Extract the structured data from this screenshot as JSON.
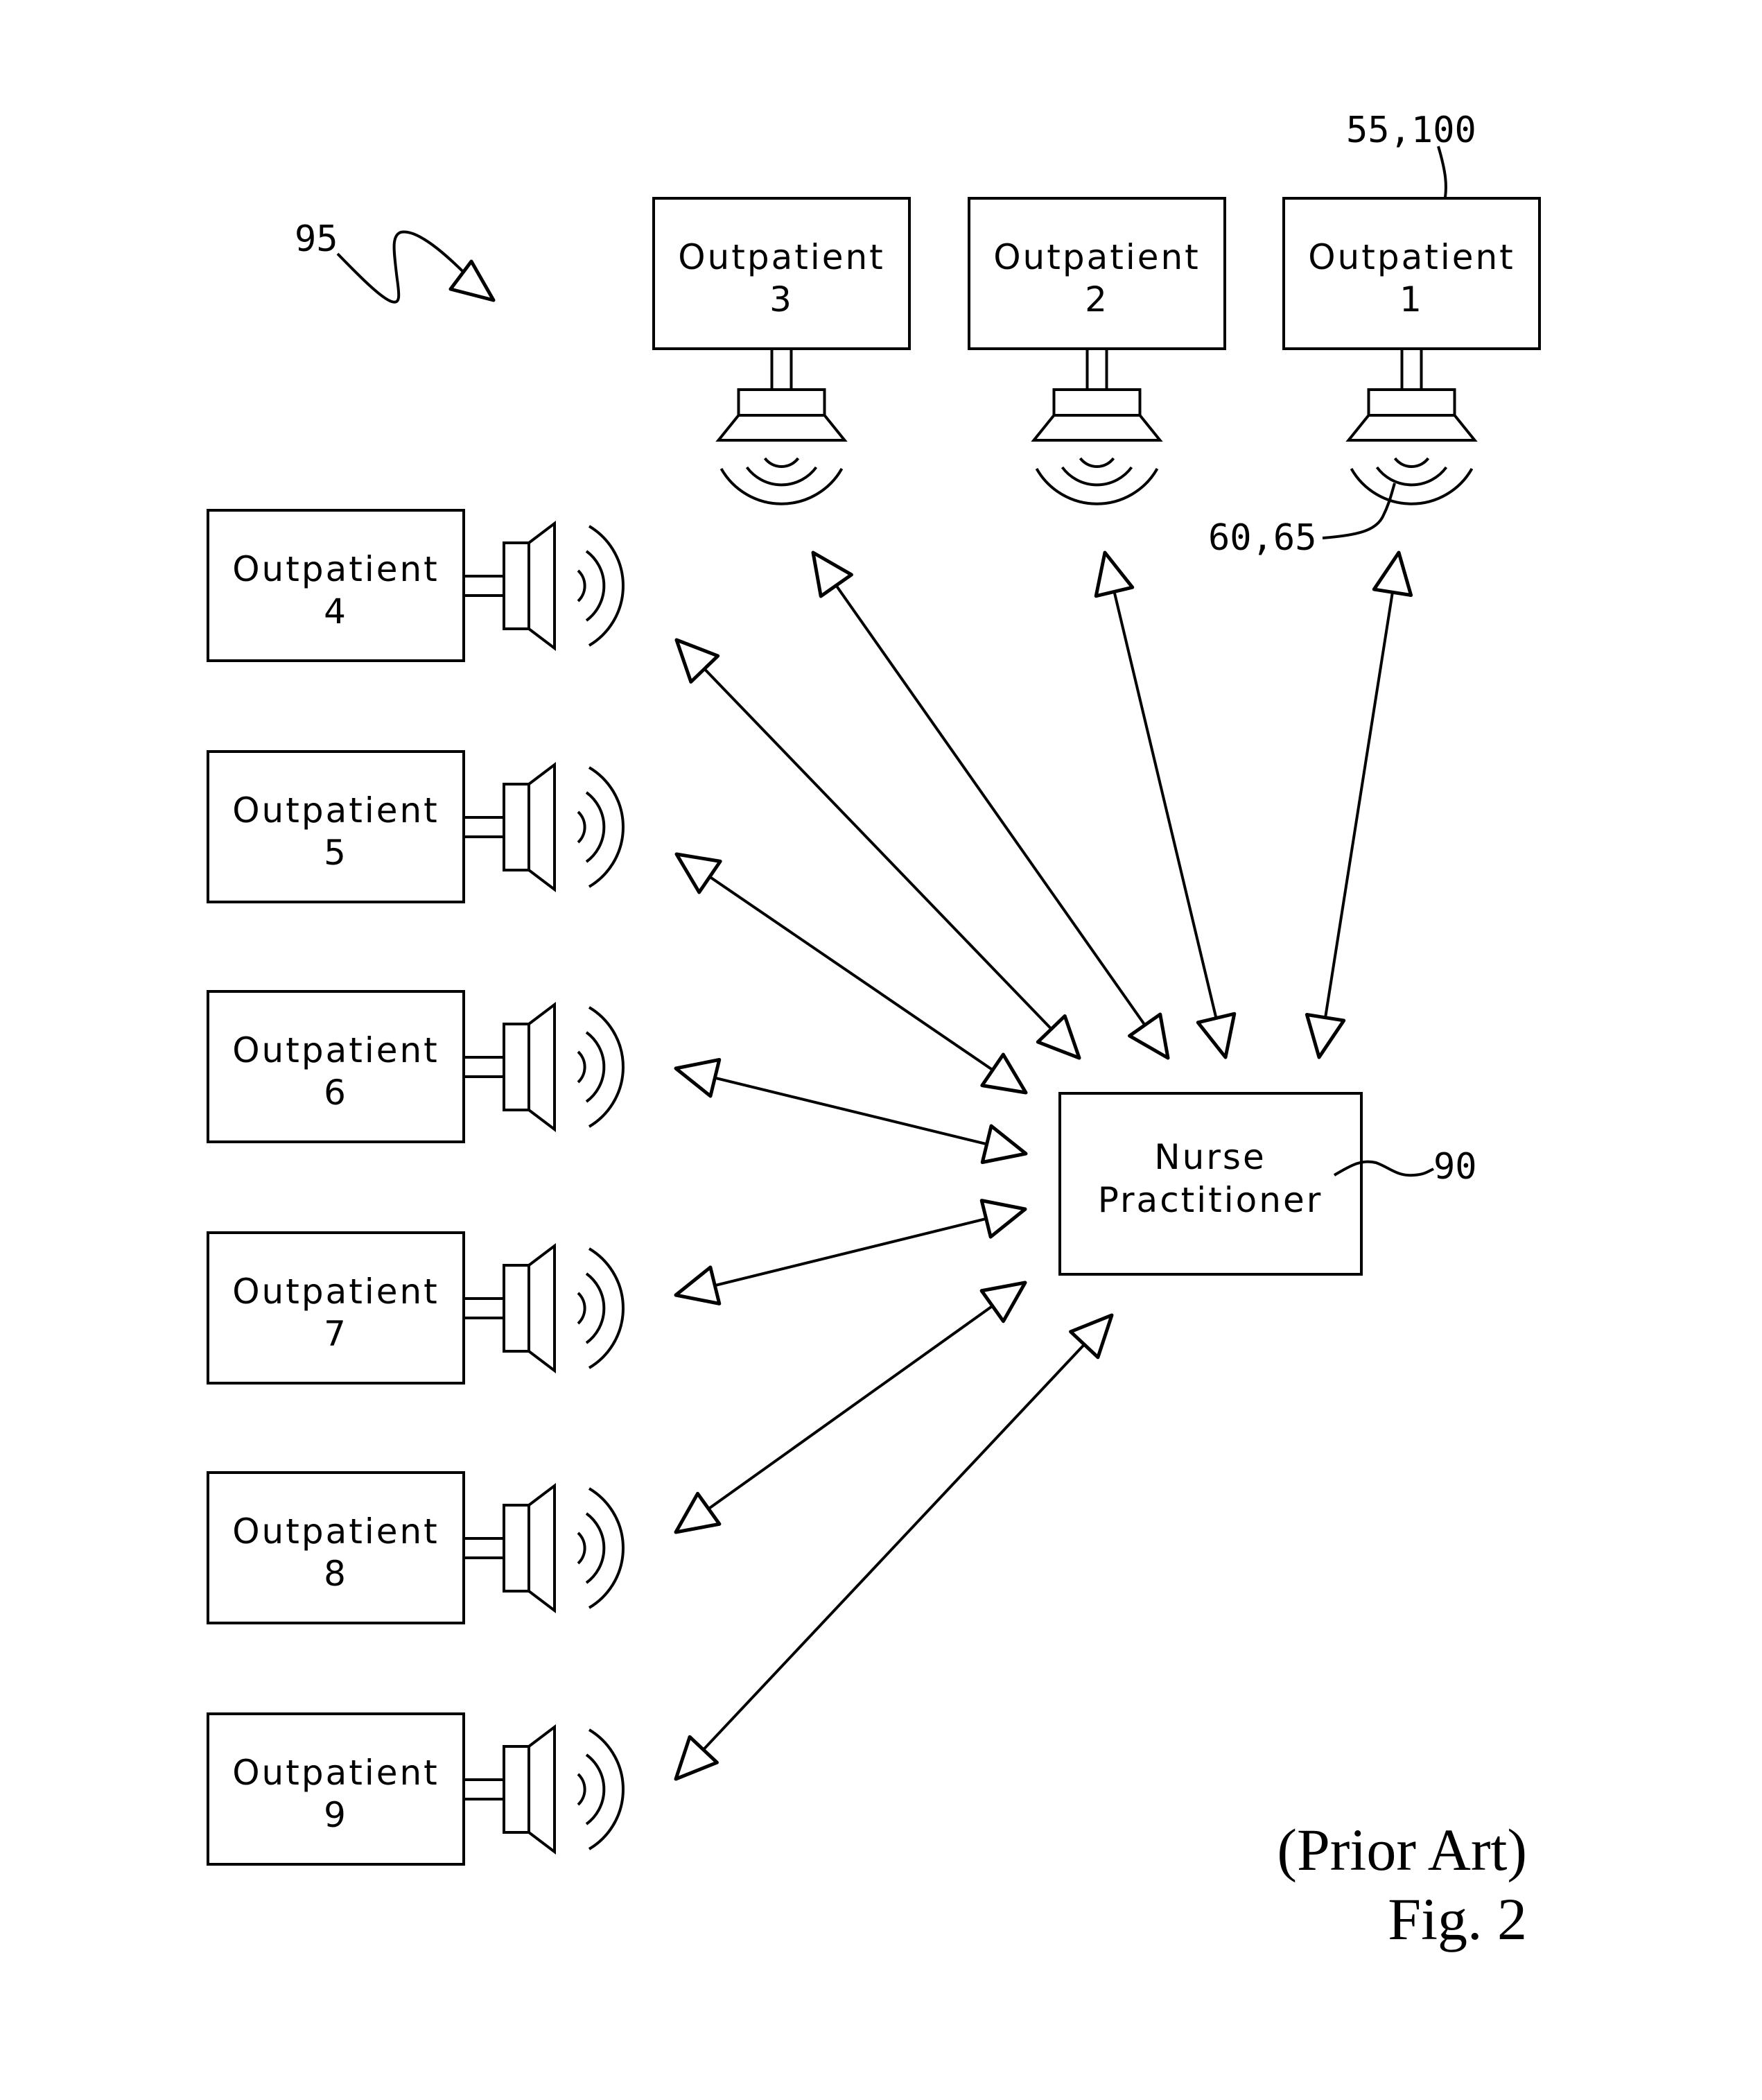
{
  "figure": {
    "ref_system": "95",
    "caption_line1": "(Prior Art)",
    "caption_line2": "Fig. 2"
  },
  "outpatients_top": [
    {
      "id": "outpatient-3",
      "label": "Outpatient",
      "number": "3"
    },
    {
      "id": "outpatient-2",
      "label": "Outpatient",
      "number": "2"
    },
    {
      "id": "outpatient-1",
      "label": "Outpatient",
      "number": "1"
    }
  ],
  "outpatients_left": [
    {
      "id": "outpatient-4",
      "label": "Outpatient",
      "number": "4"
    },
    {
      "id": "outpatient-5",
      "label": "Outpatient",
      "number": "5"
    },
    {
      "id": "outpatient-6",
      "label": "Outpatient",
      "number": "6"
    },
    {
      "id": "outpatient-7",
      "label": "Outpatient",
      "number": "7"
    },
    {
      "id": "outpatient-8",
      "label": "Outpatient",
      "number": "8"
    },
    {
      "id": "outpatient-9",
      "label": "Outpatient",
      "number": "9"
    }
  ],
  "nurse": {
    "line1": "Nurse",
    "line2": "Practitioner",
    "ref": "90"
  },
  "refs": {
    "outpatient_unit": "55,100",
    "speaker": "60,65"
  },
  "connections": [
    {
      "from": "outpatient-1",
      "to": "nurse",
      "bidirectional": true
    },
    {
      "from": "outpatient-2",
      "to": "nurse",
      "bidirectional": true
    },
    {
      "from": "outpatient-3",
      "to": "nurse",
      "bidirectional": true
    },
    {
      "from": "outpatient-4",
      "to": "nurse",
      "bidirectional": true
    },
    {
      "from": "outpatient-5",
      "to": "nurse",
      "bidirectional": true
    },
    {
      "from": "outpatient-6",
      "to": "nurse",
      "bidirectional": true
    },
    {
      "from": "outpatient-7",
      "to": "nurse",
      "bidirectional": true
    },
    {
      "from": "outpatient-8",
      "to": "nurse",
      "bidirectional": true
    },
    {
      "from": "outpatient-9",
      "to": "nurse",
      "bidirectional": true
    }
  ]
}
